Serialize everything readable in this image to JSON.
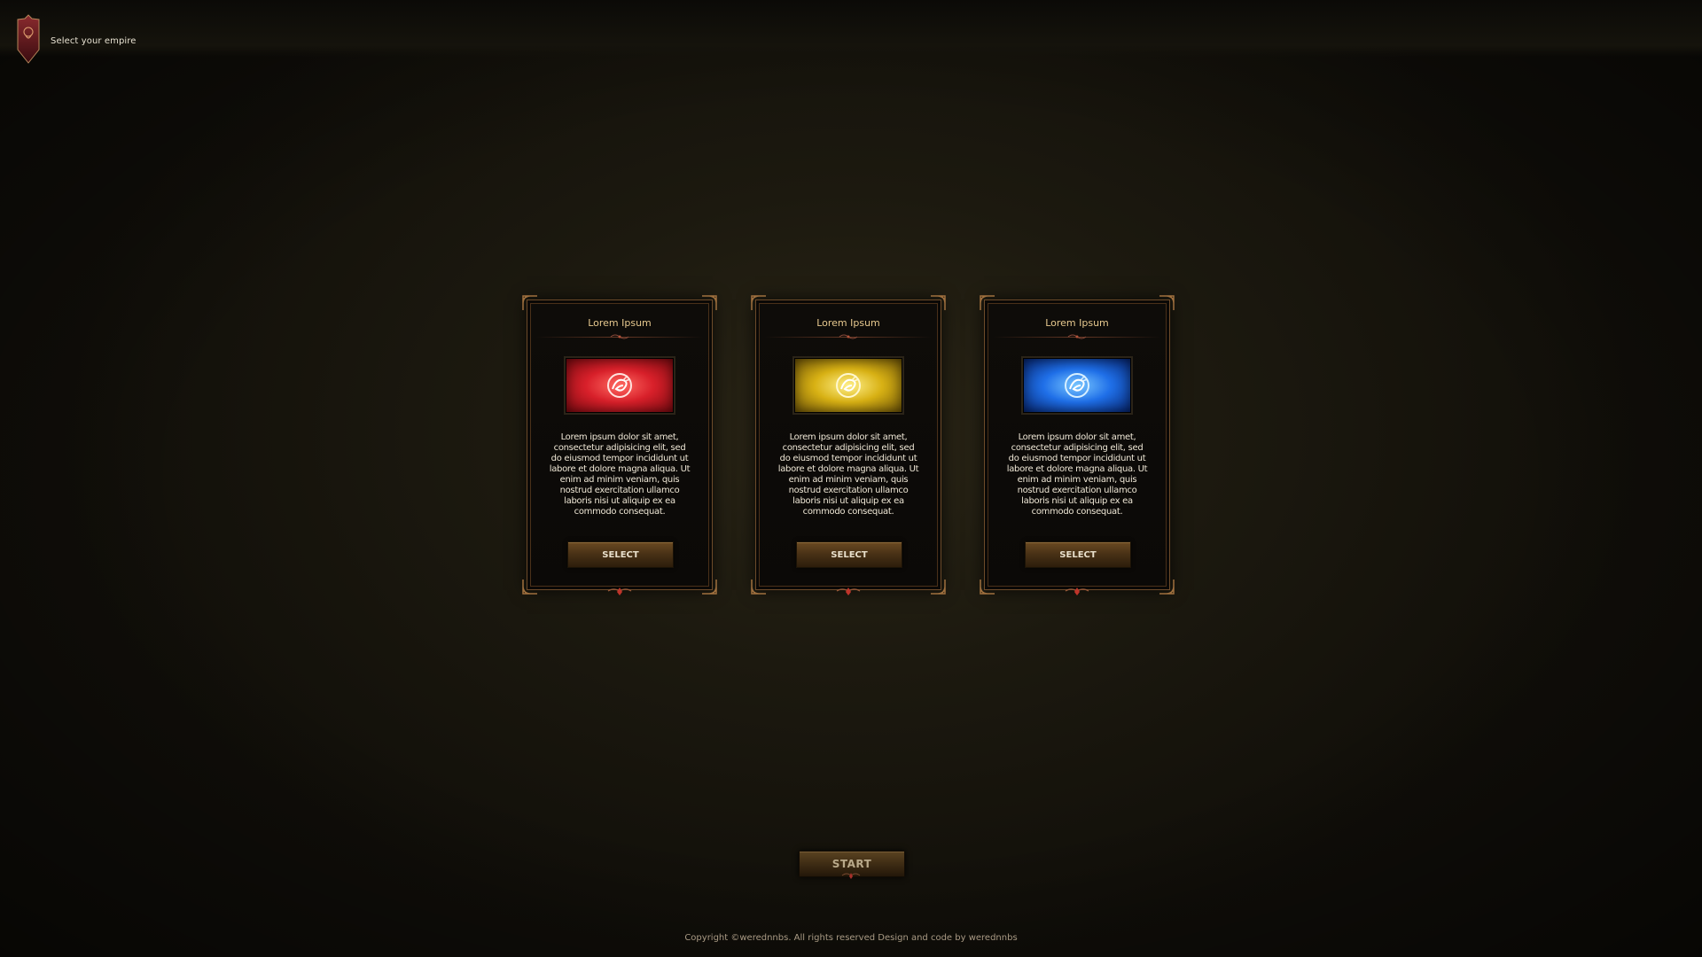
{
  "header": {
    "title": "Select your empire",
    "emblem_icon": "empire-shield-icon"
  },
  "cards": [
    {
      "title": "Lorem Ipsum",
      "description": "Lorem ipsum dolor sit amet, consectetur adipisicing elit, sed do eiusmod tempor incididunt ut labore et dolore magna aliqua. Ut enim ad minim veniam, quis nostrud exercitation ullamco laboris nisi ut aliquip ex ea commodo consequat.",
      "button_label": "SELECT",
      "banner_color": "#d8202a",
      "banner_icon": "dragon-emblem-icon"
    },
    {
      "title": "Lorem Ipsum",
      "description": "Lorem ipsum dolor sit amet, consectetur adipisicing elit, sed do eiusmod tempor incididunt ut labore et dolore magna aliqua. Ut enim ad minim veniam, quis nostrud exercitation ullamco laboris nisi ut aliquip ex ea commodo consequat.",
      "button_label": "SELECT",
      "banner_color": "#d8b114",
      "banner_icon": "dragon-emblem-icon"
    },
    {
      "title": "Lorem Ipsum",
      "description": "Lorem ipsum dolor sit amet, consectetur adipisicing elit, sed do eiusmod tempor incididunt ut labore et dolore magna aliqua. Ut enim ad minim veniam, quis nostrud exercitation ullamco laboris nisi ut aliquip ex ea commodo consequat.",
      "button_label": "SELECT",
      "banner_color": "#1f6fe8",
      "banner_icon": "dragon-emblem-icon"
    }
  ],
  "start_button": {
    "label": "START"
  },
  "footer": {
    "copyright": "Copyright ©werednnbs. All rights reserved Design and code by werednnbs"
  },
  "colors": {
    "background": "#1c190f",
    "frame_border": "#6d4b2a",
    "title_gold": "#e7c98f"
  }
}
